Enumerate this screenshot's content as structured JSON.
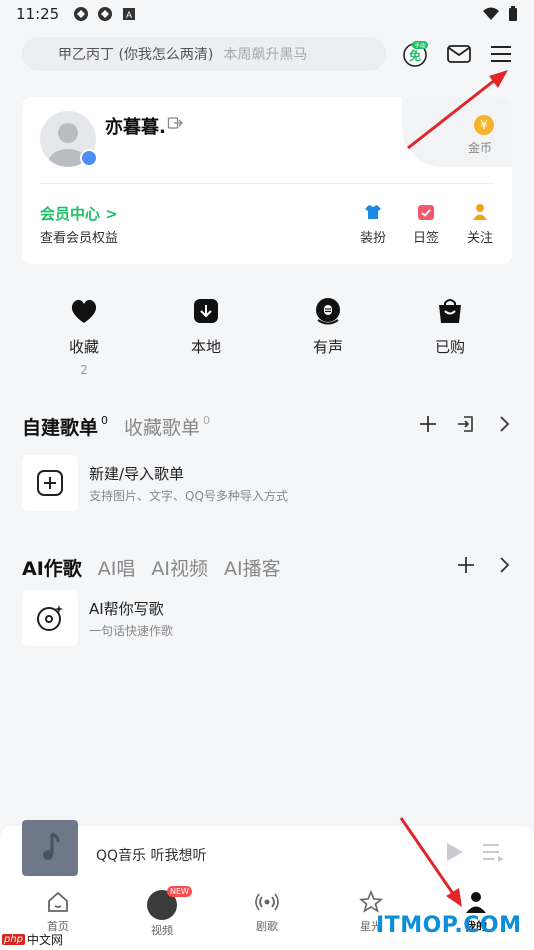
{
  "status_bar": {
    "time": "11:25"
  },
  "search": {
    "query": "甲乙丙丁 (你我怎么两清)",
    "hint": "本周飙升黑马"
  },
  "header": {
    "free_badge": "免",
    "free_tag": "手动"
  },
  "profile": {
    "name": "亦暮暮.",
    "coin_label": "金币",
    "coin_symbol": "¥",
    "vip_title": "会员中心 >",
    "vip_sub": "查看会员权益",
    "actions": [
      {
        "label": "装扮",
        "color": "#1e88e5"
      },
      {
        "label": "日签",
        "color": "#f05a6a"
      },
      {
        "label": "关注",
        "color": "#f2a21a"
      }
    ]
  },
  "quick": [
    {
      "label": "收藏",
      "count": "2"
    },
    {
      "label": "本地",
      "count": ""
    },
    {
      "label": "有声",
      "count": ""
    },
    {
      "label": "已购",
      "count": ""
    }
  ],
  "playlists": {
    "tab_active": "自建歌单",
    "tab_active_count": "0",
    "tab_other": "收藏歌单",
    "tab_other_count": "0",
    "item_title": "新建/导入歌单",
    "item_sub": "支持图片、文字、QQ号多种导入方式"
  },
  "ai": {
    "tabs": [
      "AI作歌",
      "AI唱",
      "AI视频",
      "AI播客"
    ],
    "item_title": "AI帮你写歌",
    "item_sub": "一句话快速作歌"
  },
  "player": {
    "title": "QQ音乐 听我想听"
  },
  "nav": [
    {
      "label": "首页"
    },
    {
      "label": "视频",
      "badge": "NEW"
    },
    {
      "label": "剧歌"
    },
    {
      "label": "星光"
    },
    {
      "label": "我的"
    }
  ],
  "watermarks": {
    "left_tag": "php",
    "left_text": "中文网",
    "right": "ITMOP.COM"
  },
  "colors": {
    "vip_green": "#1fbf68",
    "arrow_red": "#e0262b",
    "coin": "#f7b32b"
  }
}
